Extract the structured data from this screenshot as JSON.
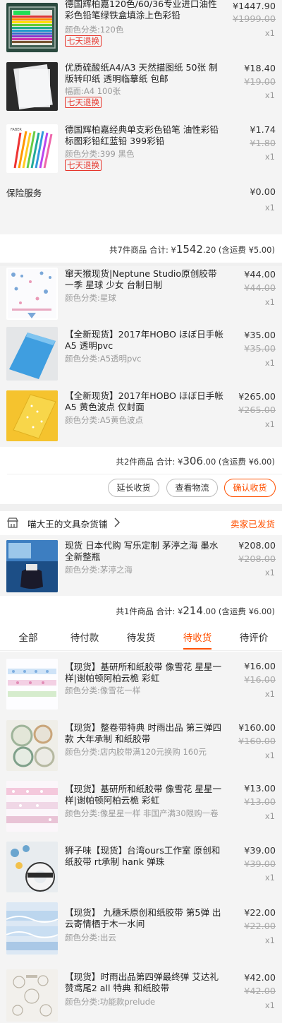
{
  "order1": {
    "items": [
      {
        "title": "德国辉柏嘉120色/60/36专业进口油性彩色铅笔绿铁盒填涂上色彩铅",
        "sku": "颜色分类:120色",
        "tag": "七天退换",
        "price": "¥1447.90",
        "original_price": "¥1999.00",
        "qty": "x1"
      },
      {
        "title": "优质硫酸纸A4/A3 天然描图纸 50张 制版转印纸 透明临摹纸 包邮",
        "sku": "幅面:A4 100张",
        "tag": "七天退换",
        "price": "¥18.40",
        "original_price": "¥19.00",
        "qty": "x1"
      },
      {
        "title": "德国辉柏嘉经典单支彩色铅笔 油性彩铅标图彩铅红蓝铅 399彩铅",
        "sku": "颜色分类:399 黑色",
        "tag": "七天退换",
        "price": "¥1.74",
        "original_price": "¥1.80",
        "qty": "x1"
      }
    ],
    "insurance": {
      "label": "保险服务",
      "price": "¥0.00",
      "qty": "x1"
    },
    "summary": {
      "prefix": "共7件商品 合计: ¥",
      "amount_int": "1542",
      "amount_dec": ".20",
      "suffix": " (含运费 ¥5.00)"
    }
  },
  "order2": {
    "items": [
      {
        "title": "窜天猴现货|Neptune Studio原创胶带一季 星球 少女 台制日制",
        "sku": "颜色分类:星球",
        "price": "¥44.00",
        "original_price": "¥44.00",
        "qty": "x1"
      },
      {
        "title": "【全新现货】2017年HOBO ほぼ日手帐A5 透明pvc",
        "sku": "颜色分类:A5透明pvc",
        "price": "¥35.00",
        "original_price": "¥35.00",
        "qty": "x1"
      },
      {
        "title": "【全新现货】2017年HOBO ほぼ日手帐A5 黄色波点 仅封面",
        "sku": "颜色分类:A5黄色波点",
        "price": "¥265.00",
        "original_price": "¥265.00",
        "qty": "x1"
      }
    ],
    "summary": {
      "prefix": "共2件商品 合计: ¥",
      "amount_int": "306",
      "amount_dec": ".00",
      "suffix": " (含运费 ¥6.00)"
    },
    "buttons": {
      "extend": "延长收货",
      "logistics": "查看物流",
      "confirm": "确认收货"
    }
  },
  "order3": {
    "shop_name": "喵大王的文具杂货铺",
    "status": "卖家已发货",
    "items": [
      {
        "title": "现货 日本代购 写乐定制 茅渟之海 墨水全新整瓶",
        "sku": "颜色分类:茅渟之海",
        "price": "¥208.00",
        "original_price": "¥208.00",
        "qty": "x1"
      }
    ],
    "summary": {
      "prefix": "共1件商品 合计: ¥",
      "amount_int": "214",
      "amount_dec": ".00",
      "suffix": " (含运费 ¥6.00)"
    }
  },
  "tabs": [
    "全部",
    "待付款",
    "待发货",
    "待收货",
    "待评价"
  ],
  "active_tab": "待收货",
  "order4": {
    "items": [
      {
        "title": "【现货】基研所和纸胶带 像雪花 星星一样|谢帕顿阿柏云桅 彩虹",
        "sku": "颜色分类:像雪花一样",
        "price": "¥16.00",
        "original_price": "¥16.00",
        "qty": "x1"
      },
      {
        "title": "【现货】整卷带特典 时雨出品 第三弹四款 大年承制 和纸胶带",
        "sku": "颜色分类:店内胶带满120元换购 160元",
        "price": "¥160.00",
        "original_price": "¥160.00",
        "qty": "x1"
      },
      {
        "title": "【现货】基研所和纸胶带 像雪花 星星一样|谢帕顿阿柏云桅 彩虹",
        "sku": "颜色分类:像星星一样 非国产满30限购一卷",
        "price": "¥13.00",
        "original_price": "¥13.00",
        "qty": "x1"
      },
      {
        "title": "狮子味【现货】台湾ours工作室 原创和纸胶带 rt承制 hank 弹珠",
        "sku": "",
        "price": "¥39.00",
        "original_price": "¥39.00",
        "qty": "x1"
      },
      {
        "title": "【现货】 九穗禾原创和纸胶带 第5弹 出云寄情栖于木一水间",
        "sku": "颜色分类:出云",
        "price": "¥22.00",
        "original_price": "¥22.00",
        "qty": "x1"
      },
      {
        "title": "【现货】时雨出品第四弹最终弹 艾达礼赞鸢尾2 all 特典 和纸胶带",
        "sku": "颜色分类:功能款prelude",
        "price": "¥42.00",
        "original_price": "¥42.00",
        "qty": "x1"
      }
    ]
  },
  "colors": {
    "accent": "#ff5000",
    "tag_red": "#e6352b",
    "item_bg": "#f4f4f4"
  }
}
